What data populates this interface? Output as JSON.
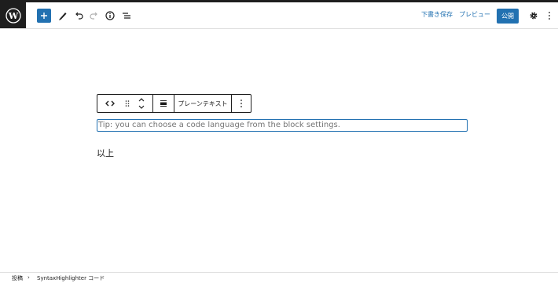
{
  "header": {
    "logo_icon": "wordpress-logo-icon",
    "add_icon": "plus-icon",
    "tools_icon": "pencil-icon",
    "undo_icon": "undo-icon",
    "redo_icon": "redo-icon",
    "info_icon": "info-icon",
    "list_view_icon": "list-view-icon",
    "save_draft_label": "下書き保存",
    "preview_label": "プレビュー",
    "publish_label": "公開",
    "settings_icon": "gear-icon",
    "options_icon": "more-vertical-icon"
  },
  "block_toolbar": {
    "code_icon": "code-icon",
    "drag_icon": "drag-handle-icon",
    "move_icon": "chevron-up-down-icon",
    "align_icon": "align-icon",
    "language_label": "プレーンテキスト",
    "options_icon": "more-vertical-icon"
  },
  "content": {
    "code_placeholder": "Tip: you can choose a code language from the block settings.",
    "paragraph_text": "以上"
  },
  "footer": {
    "breadcrumb": [
      "投稿",
      "SyntaxHighlighter コード"
    ],
    "separator": "›"
  },
  "colors": {
    "accent": "#2271b1",
    "dark": "#1e1e1e"
  }
}
